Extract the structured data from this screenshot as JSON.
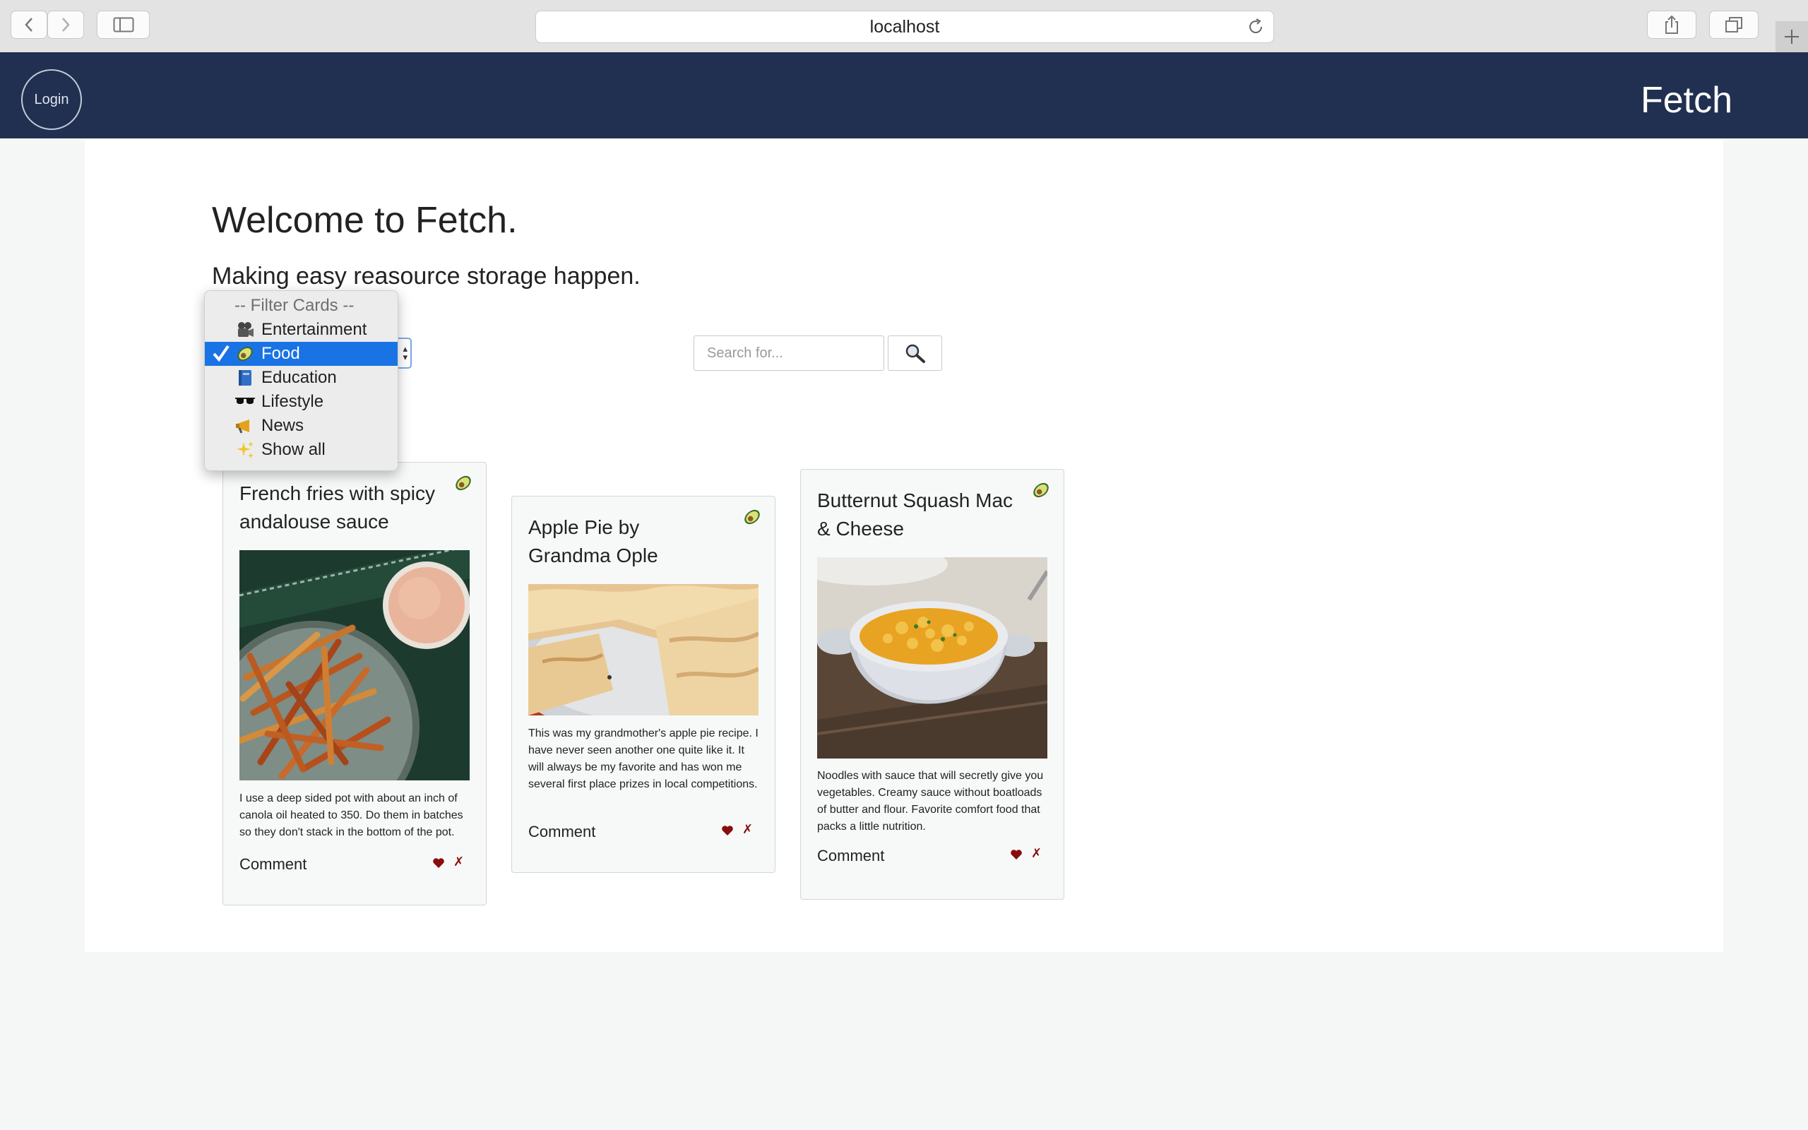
{
  "browser": {
    "url": "localhost"
  },
  "nav": {
    "login_label": "Login",
    "brand": "Fetch"
  },
  "hero": {
    "title": "Welcome to Fetch.",
    "subtitle": "Making easy reasource storage happen."
  },
  "filter": {
    "header": "-- Filter Cards --",
    "selected": "Food",
    "options": [
      {
        "emoji_icon": "movie-camera-icon",
        "label": "Entertainment"
      },
      {
        "emoji_icon": "avocado-icon",
        "label": "Food"
      },
      {
        "emoji_icon": "blue-book-icon",
        "label": "Education"
      },
      {
        "emoji_icon": "sunglasses-icon",
        "label": "Lifestyle"
      },
      {
        "emoji_icon": "megaphone-icon",
        "label": "News"
      },
      {
        "emoji_icon": "sparkles-icon",
        "label": "Show all"
      }
    ]
  },
  "search": {
    "placeholder": "Search for..."
  },
  "cards": [
    {
      "title": "French fries with spicy andalouse sauce",
      "category_icon": "avocado-icon",
      "image": "french-fries-photo",
      "description": "I use a deep sided pot with about an inch of canola oil heated to 350. Do them in batches so they don't stack in the bottom of the pot.",
      "comment_label": "Comment",
      "delete_symbol": "✗"
    },
    {
      "title": "Apple Pie by Grandma Ople",
      "category_icon": "avocado-icon",
      "image": "apple-pie-photo",
      "description": "This was my grandmother's apple pie recipe. I have never seen another one quite like it. It will always be my favorite and has won me several first place prizes in local competitions.",
      "comment_label": "Comment",
      "delete_symbol": "✗"
    },
    {
      "title": "Butternut Squash Mac & Cheese",
      "category_icon": "avocado-icon",
      "image": "mac-and-cheese-photo",
      "description": "Noodles with sauce that will secretly give you vegetables. Creamy sauce without boatloads of butter and flour. Favorite comfort food that packs a little nutrition.",
      "comment_label": "Comment",
      "delete_symbol": "✗"
    }
  ],
  "colors": {
    "navbar": "#213050",
    "selection": "#1a73e5",
    "heart": "#8a0d0d"
  }
}
